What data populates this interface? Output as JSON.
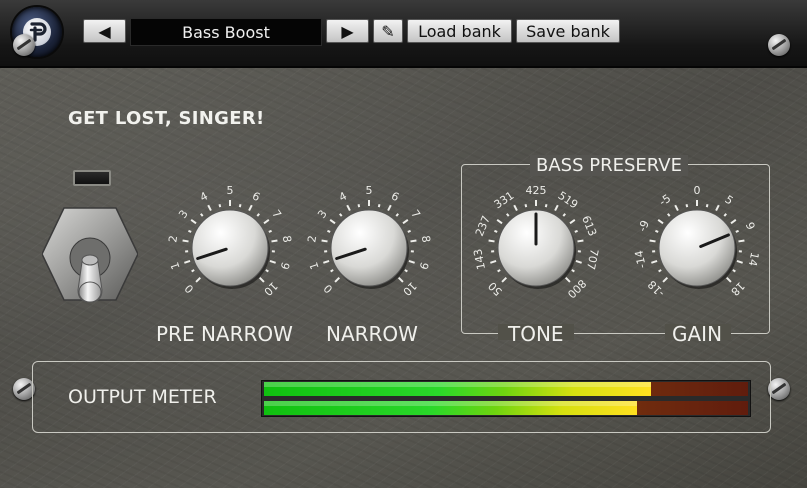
{
  "toolbar": {
    "prev_symbol": "◀",
    "next_symbol": "▶",
    "edit_symbol": "✎",
    "preset_name": "Bass Boost",
    "load_bank_label": "Load bank",
    "save_bank_label": "Save bank"
  },
  "plugin": {
    "title": "GET LOST, SINGER!"
  },
  "knobs": {
    "pre_narrow": {
      "label": "PRE NARROW",
      "scale": [
        "0",
        "1",
        "2",
        "3",
        "4",
        "5",
        "6",
        "7",
        "8",
        "9",
        "10"
      ],
      "value": 0.1
    },
    "narrow": {
      "label": "NARROW",
      "scale": [
        "0",
        "1",
        "2",
        "3",
        "4",
        "5",
        "6",
        "7",
        "8",
        "9",
        "10"
      ],
      "value": 0.1
    },
    "tone": {
      "label": "TONE",
      "scale": [
        "50",
        "143",
        "237",
        "331",
        "425",
        "519",
        "613",
        "707",
        "800"
      ],
      "value": 0.5
    },
    "gain": {
      "label": "GAIN",
      "scale": [
        "-18",
        "-14",
        "-9",
        "-5",
        "0",
        "5",
        "9",
        "14",
        "18"
      ],
      "value": 0.75
    }
  },
  "bass_preserve": {
    "title": "BASS PRESERVE"
  },
  "meter": {
    "label": "OUTPUT METER",
    "left_level": 0.8,
    "right_level": 0.77
  },
  "colors": {
    "panel": "#55544e",
    "meter_green": "#2ad82a",
    "meter_yellow": "#ffe020",
    "meter_red": "#8a1a0a"
  },
  "icons": {
    "logo": "stylized-p-logo-icon",
    "edit": "pencil-icon",
    "prev": "triangle-left-icon",
    "next": "triangle-right-icon"
  }
}
